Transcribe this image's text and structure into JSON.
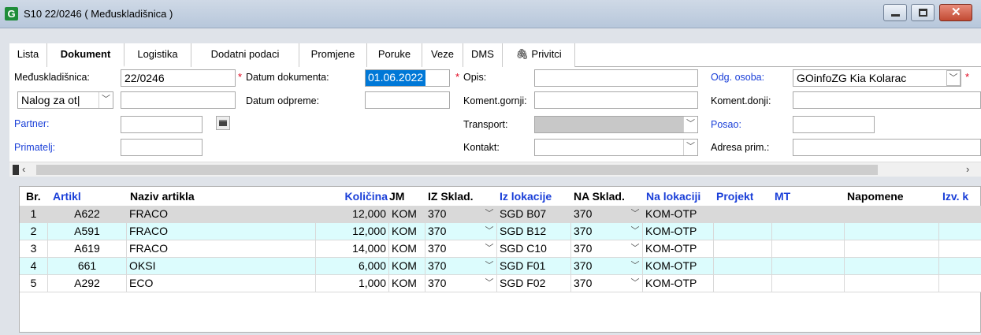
{
  "window": {
    "title": "S10 22/0246  ( Međuskladišnica )",
    "app_icon_letter": "G"
  },
  "tabs": [
    {
      "label": "Lista"
    },
    {
      "label": "Dokument"
    },
    {
      "label": "Logistika"
    },
    {
      "label": "Dodatni podaci"
    },
    {
      "label": "Promjene"
    },
    {
      "label": "Poruke"
    },
    {
      "label": "Veze"
    },
    {
      "label": "DMS"
    },
    {
      "label": "Privitci"
    }
  ],
  "form": {
    "meduskladisnica_label": "Međuskladišnica:",
    "meduskladisnica_value": "22/0246",
    "nalog_value": "Nalog za ot|",
    "partner_label": "Partner:",
    "primatelj_label": "Primatelj:",
    "datum_dokumenta_label": "Datum dokumenta:",
    "datum_dokumenta_value": "01.06.2022",
    "datum_odpreme_label": "Datum odpreme:",
    "opis_label": "Opis:",
    "koment_gornji_label": "Koment.gornji:",
    "transport_label": "Transport:",
    "kontakt_label": "Kontakt:",
    "odg_osoba_label": "Odg. osoba:",
    "odg_osoba_value": "GOinfoZG Kia Kolarac",
    "koment_donji_label": "Koment.donji:",
    "posao_label": "Posao:",
    "adresa_prim_label": "Adresa prim.:",
    "required_mark": "*"
  },
  "grid": {
    "headers": [
      "Br.",
      "Artikl",
      "Naziv artikla",
      "Količina",
      "JM",
      "IZ Sklad.",
      "Iz lokacije",
      "NA Sklad.",
      "Na lokaciji",
      "Projekt",
      "MT",
      "Napomene",
      "Izv. k"
    ],
    "rows": [
      {
        "br": "1",
        "artikl": "A622",
        "naziv": "FRACO",
        "kolicina": "12,000",
        "jm": "KOM",
        "iz_sklad": "370",
        "iz_lok": "SGD B07",
        "na_sklad": "370",
        "na_lok": "KOM-OTP"
      },
      {
        "br": "2",
        "artikl": "A591",
        "naziv": "FRACO",
        "kolicina": "12,000",
        "jm": "KOM",
        "iz_sklad": "370",
        "iz_lok": "SGD B12",
        "na_sklad": "370",
        "na_lok": "KOM-OTP"
      },
      {
        "br": "3",
        "artikl": "A619",
        "naziv": "FRACO",
        "kolicina": "14,000",
        "jm": "KOM",
        "iz_sklad": "370",
        "iz_lok": "SGD C10",
        "na_sklad": "370",
        "na_lok": "KOM-OTP"
      },
      {
        "br": "4",
        "artikl": "661",
        "naziv": "OKSI",
        "kolicina": "6,000",
        "jm": "KOM",
        "iz_sklad": "370",
        "iz_lok": "SGD F01",
        "na_sklad": "370",
        "na_lok": "KOM-OTP"
      },
      {
        "br": "5",
        "artikl": "A292",
        "naziv": "ECO",
        "kolicina": "1,000",
        "jm": "KOM",
        "iz_sklad": "370",
        "iz_lok": "SGD F02",
        "na_sklad": "370",
        "na_lok": "KOM-OTP"
      }
    ]
  },
  "colors": {
    "row_alt": "#dcfcfd",
    "row_selected": "#d9d9d9",
    "link_blue": "#1a3fd8",
    "required_red": "#e0001a"
  }
}
